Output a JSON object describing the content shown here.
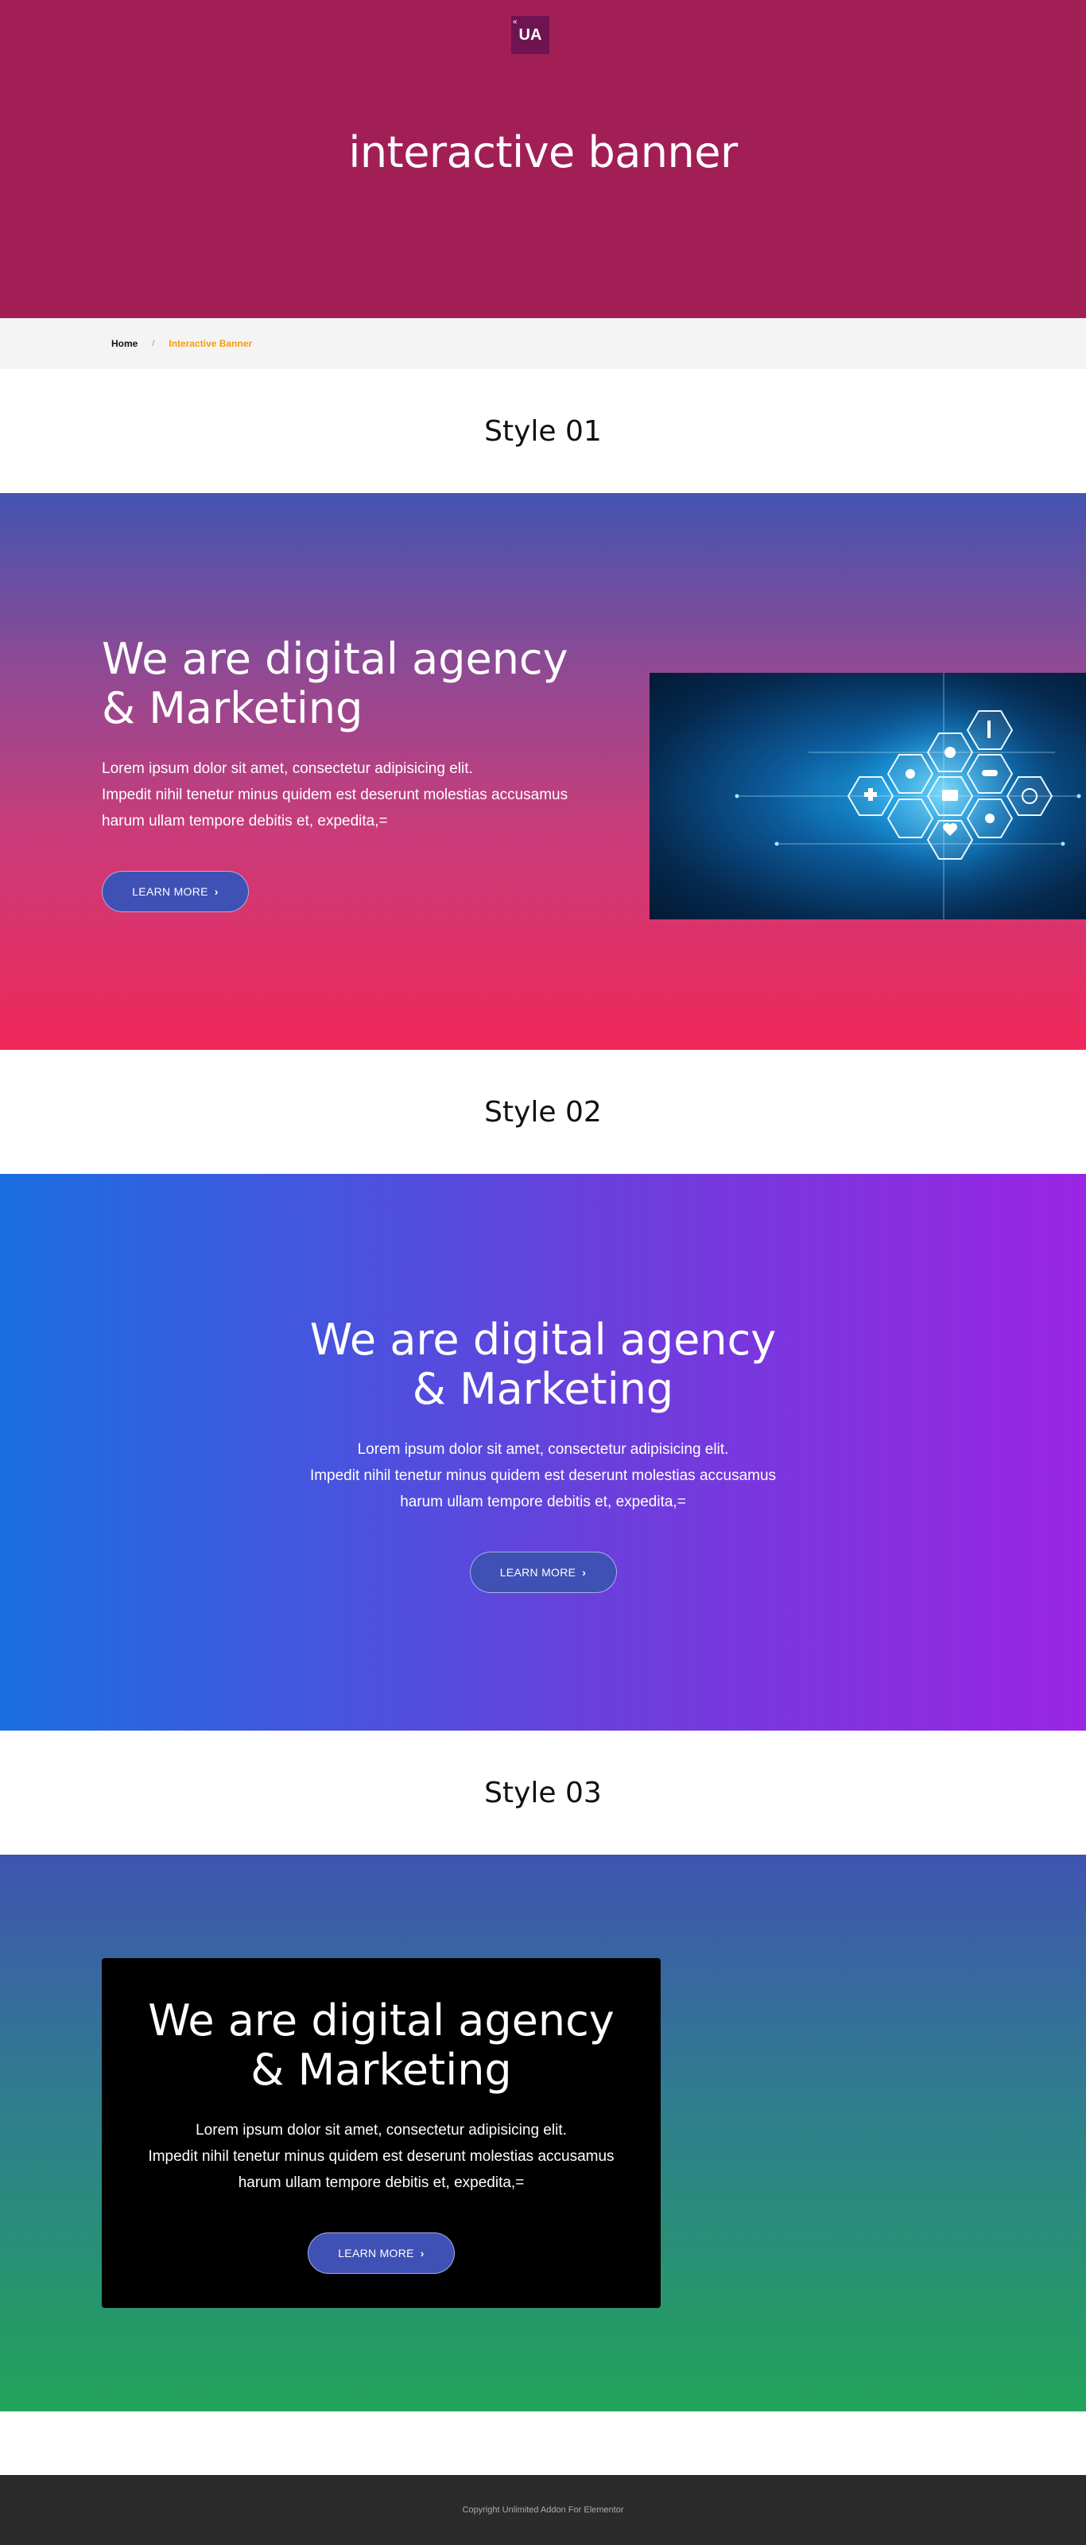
{
  "header": {
    "logo_text": "UA",
    "logo_mark": "«",
    "title": "interactive banner"
  },
  "breadcrumb": {
    "home": "Home",
    "separator": "/",
    "current": "Interactive Banner"
  },
  "sections": {
    "style1_heading": "Style 01",
    "style2_heading": "Style 02",
    "style3_heading": "Style 03"
  },
  "banner1": {
    "title_line1": "We are digital agency",
    "title_line2": "& Marketing",
    "text_line1": "Lorem ipsum dolor sit amet, consectetur adipisicing elit.",
    "text_line2": "Impedit nihil tenetur minus quidem est deserunt molestias accusamus",
    "text_line3": "harum ullam tempore debitis et, expedita,=",
    "button_label": "LEARN MORE",
    "image_icon": "medical-icons-hexagon-illustration"
  },
  "banner2": {
    "title_line1": "We are digital agency",
    "title_line2": "& Marketing",
    "text_line1": "Lorem ipsum dolor sit amet, consectetur adipisicing elit.",
    "text_line2": "Impedit nihil tenetur minus quidem est deserunt molestias accusamus",
    "text_line3": "harum ullam tempore debitis et, expedita,=",
    "button_label": "LEARN MORE"
  },
  "banner3": {
    "title_line1": "We are digital agency",
    "title_line2": "& Marketing",
    "text_line1": "Lorem ipsum dolor sit amet, consectetur adipisicing elit.",
    "text_line2": "Impedit nihil tenetur minus quidem est deserunt molestias accusamus",
    "text_line3": "harum ullam tempore debitis et, expedita,=",
    "button_label": "LEARN MORE"
  },
  "footer": {
    "copyright": "Copyright Unlimited Addon For Elementor"
  },
  "colors": {
    "header_bg": "#a21f56",
    "breadcrumb_active": "#f39c12",
    "button_bg": "#3f51b5",
    "footer_bg": "#2b2b2b"
  }
}
